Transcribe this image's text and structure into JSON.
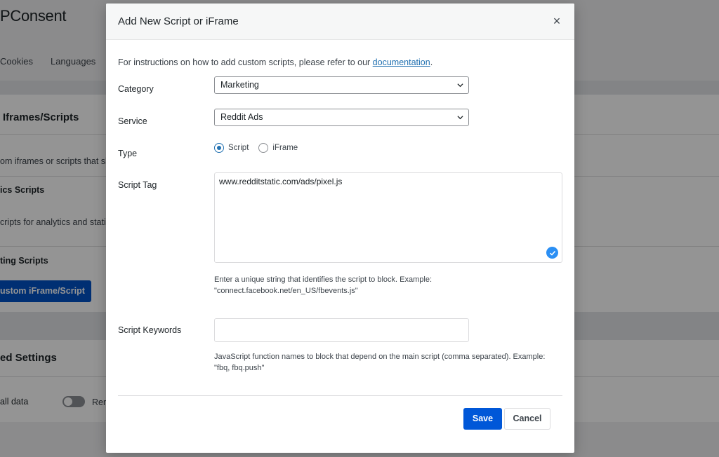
{
  "background": {
    "logo": "PConsent",
    "nav": [
      "Cookies",
      "Languages"
    ],
    "section_title": "Iframes/Scripts",
    "section_desc": "om iframes or scripts that sh",
    "analytics_heading": "ics Scripts",
    "analytics_desc": "cripts for analytics and statist",
    "marketing_heading": "ting Scripts",
    "add_button": "ustom iFrame/Script",
    "advanced_title": "ed Settings",
    "uninstall_label": "all data",
    "toggle_text": "Rem"
  },
  "modal": {
    "title": "Add New Script or iFrame",
    "close_symbol": "×",
    "intro_text": "For instructions on how to add custom scripts, please refer to our ",
    "intro_link": "documentation",
    "intro_end": ".",
    "category": {
      "label": "Category",
      "value": "Marketing"
    },
    "service": {
      "label": "Service",
      "value": "Reddit Ads"
    },
    "type": {
      "label": "Type",
      "options": [
        "Script",
        "iFrame"
      ],
      "selected": "Script"
    },
    "script_tag": {
      "label": "Script Tag",
      "value": "www.redditstatic.com/ads/pixel.js",
      "help_line1": "Enter a unique string that identifies the script to block. Example:",
      "help_line2": "\"connect.facebook.net/en_US/fbevents.js\""
    },
    "script_keywords": {
      "label": "Script Keywords",
      "value": "",
      "help_line1": "JavaScript function names to block that depend on the main script (comma separated). Example:",
      "help_line2": "\"fbq, fbq.push\""
    },
    "save_label": "Save",
    "cancel_label": "Cancel"
  },
  "colors": {
    "primary": "#0057d8",
    "link": "#2271b1",
    "check_badge": "#2b8ff4"
  }
}
